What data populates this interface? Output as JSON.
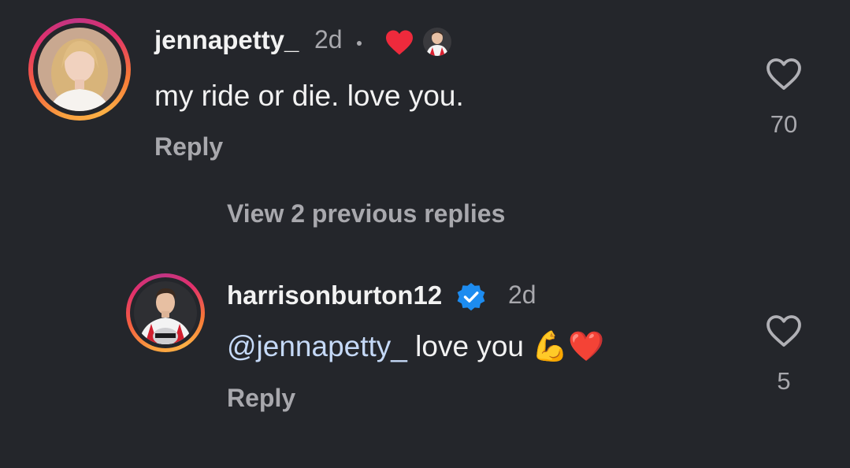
{
  "comments": [
    {
      "username": "jennapetty_",
      "time": "2d",
      "text": "my ride or die. love you.",
      "reply_label": "Reply",
      "like_count": "70",
      "creator_liked": true
    }
  ],
  "view_previous_replies": "View 2 previous replies",
  "replies": [
    {
      "username": "harrisonburton12",
      "verified": true,
      "time": "2d",
      "mention": "@jennapetty_",
      "text": " love you ",
      "emoji": [
        "💪",
        "❤️"
      ],
      "reply_label": "Reply",
      "like_count": "5"
    }
  ],
  "icons": {
    "like": "heart-outline-icon",
    "creator_like": "heart-filled-icon",
    "verified": "verified-badge-icon"
  },
  "colors": {
    "background": "#24262b",
    "text_primary": "#f2f2f2",
    "text_secondary": "#a8a8ad",
    "mention": "#c5d9f7",
    "heart_red": "#ee2a3c",
    "verified_blue": "#1d8cf0"
  }
}
